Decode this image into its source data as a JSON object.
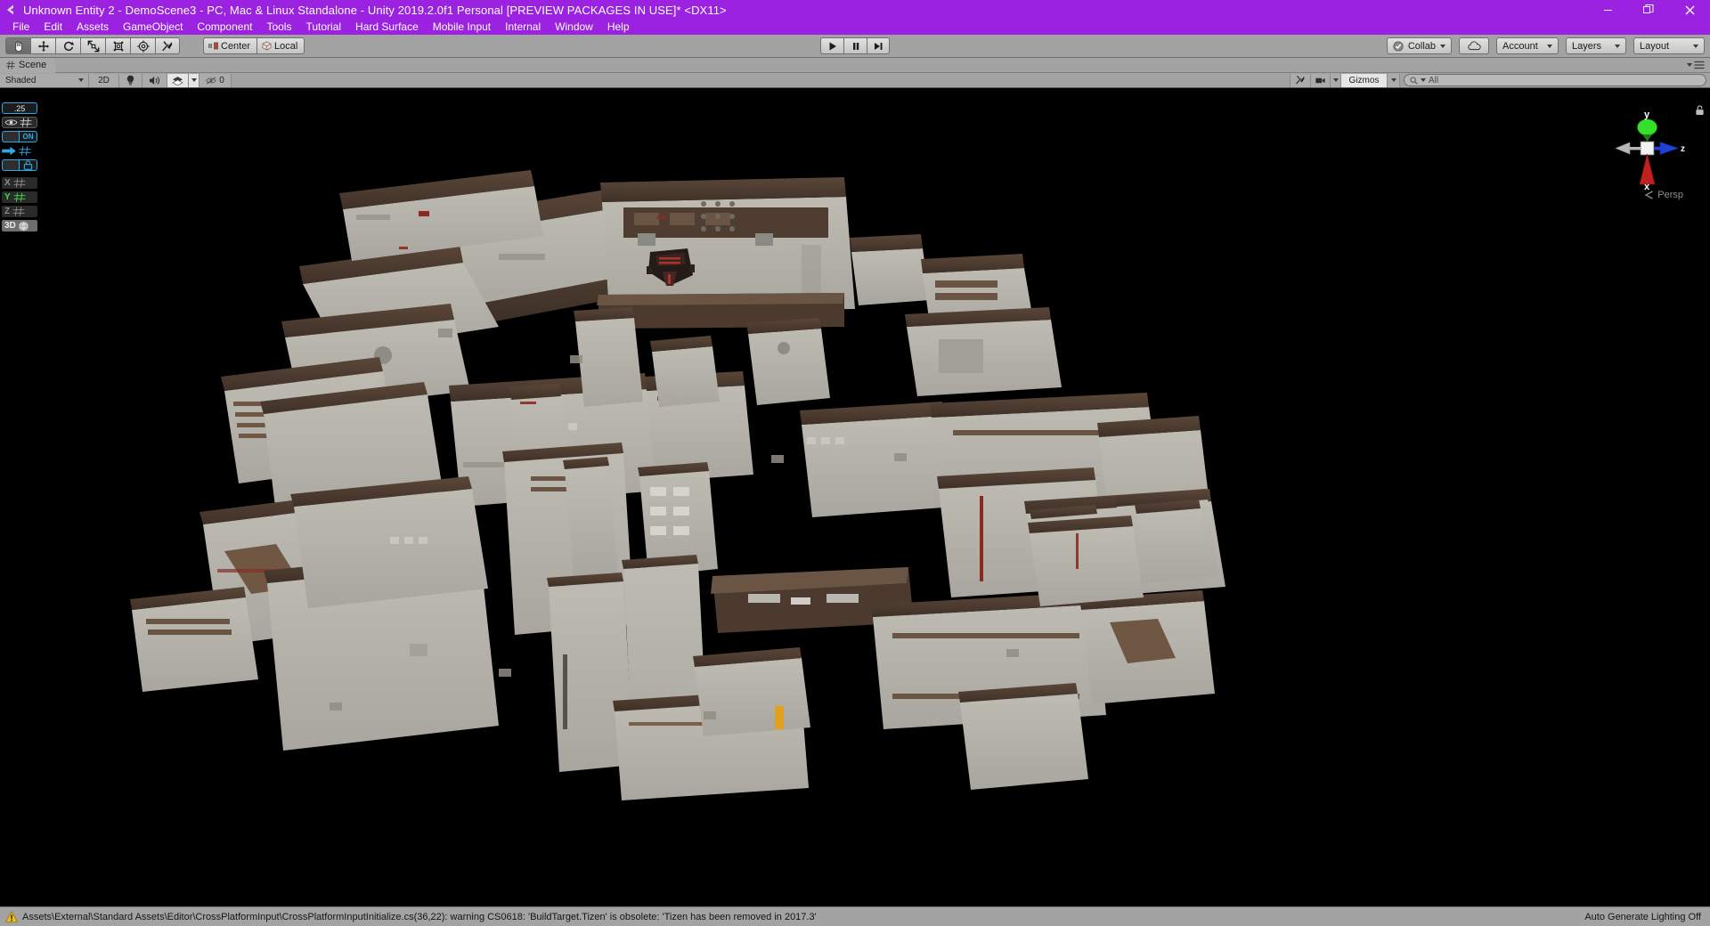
{
  "window": {
    "title": "Unknown Entity 2 - DemoScene3 - PC, Mac & Linux Standalone - Unity 2019.2.0f1 Personal [PREVIEW PACKAGES IN USE]* <DX11>",
    "app_icon": "unity-logo-icon",
    "minimize_label": "—",
    "restore_label": "❐",
    "close_label": "✕",
    "titlebar_color": "#9a22e0"
  },
  "menubar": {
    "items": [
      {
        "label": "File"
      },
      {
        "label": "Edit"
      },
      {
        "label": "Assets"
      },
      {
        "label": "GameObject"
      },
      {
        "label": "Component"
      },
      {
        "label": "Tools"
      },
      {
        "label": "Tutorial"
      },
      {
        "label": "Hard Surface"
      },
      {
        "label": "Mobile Input"
      },
      {
        "label": "Internal"
      },
      {
        "label": "Window"
      },
      {
        "label": "Help"
      }
    ]
  },
  "toolbar": {
    "tools": [
      {
        "name": "hand-tool",
        "active": true
      },
      {
        "name": "move-tool",
        "active": false
      },
      {
        "name": "rotate-tool",
        "active": false
      },
      {
        "name": "scale-tool",
        "active": false
      },
      {
        "name": "rect-tool",
        "active": false
      },
      {
        "name": "transform-tool",
        "active": false
      },
      {
        "name": "custom-editor-tool",
        "active": false
      }
    ],
    "pivot_label": "Center",
    "handle_label": "Local",
    "play_label": "▶",
    "pause_label": "❙❙",
    "step_label": "▶❙",
    "collab_label": "Collab",
    "cloud_label": "cloud-button",
    "account_label": "Account",
    "layers_label": "Layers",
    "layout_label": "Layout"
  },
  "scene_tab": {
    "icon": "grid-hash-icon",
    "label": "Scene",
    "menu_icon": "hamburger-menu-icon"
  },
  "scene_toolbar": {
    "draw_mode": "Shaded",
    "mode_2d": "2D",
    "lighting_icon": "lightbulb-icon",
    "audio_icon": "speaker-icon",
    "fx_icon": "effects-icon",
    "hidden_count": "0",
    "gizmos_label": "Gizmos",
    "search_placeholder": "All",
    "search_value": "",
    "camera_icon": "camera-icon",
    "tools_icon": "tools-icon"
  },
  "grid_widget": {
    "snap_value": ".25",
    "visibility_icon": "eye-grid-icon",
    "toggle_state": "ON",
    "move_icon": "arrow-grid-icon",
    "lock_icon": "lock-grid-icon",
    "axes": [
      {
        "label": "X",
        "active": false
      },
      {
        "label": "Y",
        "active": true
      },
      {
        "label": "Z",
        "active": false
      }
    ],
    "mode_3d": "3D",
    "accent_color": "#2fa8e8",
    "active_axis_color": "#3ddc4a"
  },
  "scene_gizmo": {
    "y_label": "y",
    "x_label": "x",
    "z_label": "z",
    "projection": "Persp",
    "y_color": "#35e02a",
    "x_color": "#c02020",
    "z_color": "#2040d8",
    "lock_icon": "padlock-icon"
  },
  "statusbar": {
    "warning_icon": "warning-triangle-icon",
    "message": "Assets\\External\\Standard Assets\\Editor\\CrossPlatformInput\\CrossPlatformInputInitialize.cs(36,22): warning CS0618: 'BuildTarget.Tizen' is obsolete: 'Tizen has been removed in 2017.3'",
    "lighting_status": "Auto Generate Lighting Off"
  },
  "scene": {
    "background": "#000000",
    "floor_color": "#b6b4ac",
    "floor_color_dark": "#9a978f",
    "wall_color": "#4c3b31",
    "wall_color_light": "#5e4a3c",
    "accent_red": "#8a2b22",
    "description": "Top-down isometric view of a large modular sci-fi space station interior composed of gray floor modules and brown walls, with a dark red dropship parked in the upper-right hangar bay."
  }
}
